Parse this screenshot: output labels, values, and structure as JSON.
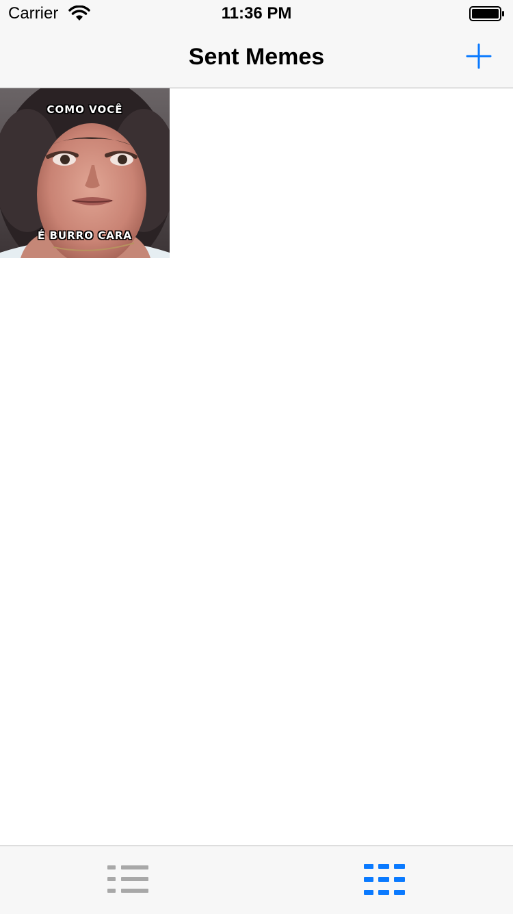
{
  "status_bar": {
    "carrier": "Carrier",
    "time": "11:36 PM",
    "wifi_icon": "wifi-icon",
    "battery_icon": "battery-full-icon"
  },
  "nav": {
    "title": "Sent Memes",
    "add_icon": "plus-icon",
    "accent_color": "#0a7aff"
  },
  "memes": [
    {
      "top_text": "COMO VOCÊ",
      "bottom_text": "É BURRO CARA"
    }
  ],
  "tab_bar": {
    "tabs": [
      {
        "name": "table-view",
        "icon": "list-icon",
        "selected": false,
        "color": "#a8a8a8"
      },
      {
        "name": "collection-view",
        "icon": "grid-icon",
        "selected": true,
        "color": "#0a7aff"
      }
    ]
  }
}
